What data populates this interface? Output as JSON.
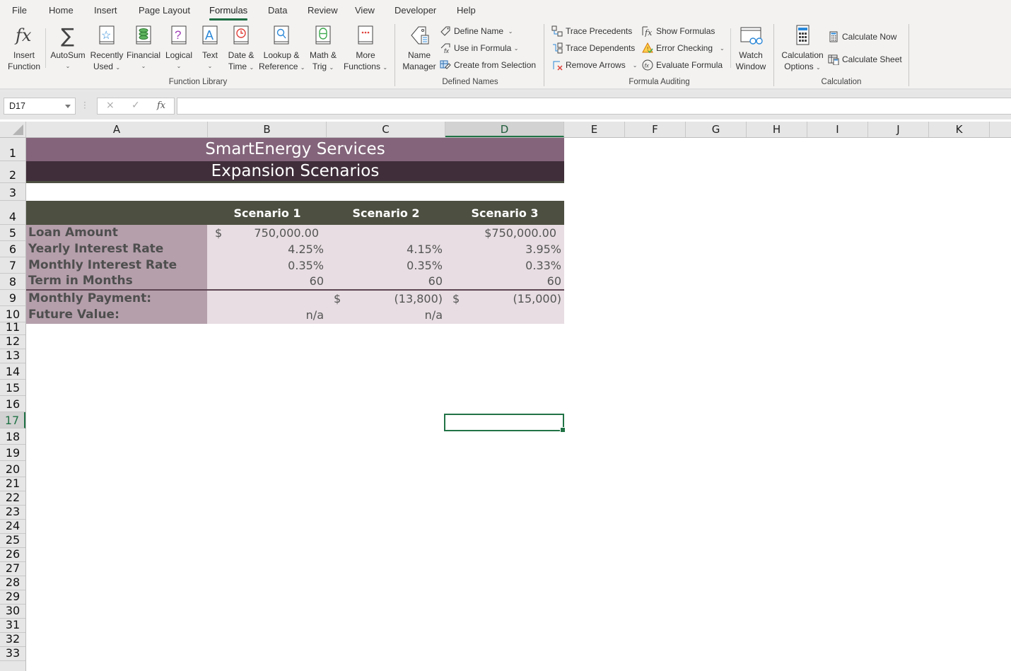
{
  "menu": {
    "tabs": [
      "File",
      "Home",
      "Insert",
      "Page Layout",
      "Formulas",
      "Data",
      "Review",
      "View",
      "Developer",
      "Help"
    ],
    "active_tab": "Formulas"
  },
  "ribbon": {
    "function_library": {
      "label": "Function Library",
      "insert_function": [
        "Insert",
        "Function"
      ],
      "autosum": "AutoSum",
      "recently_used": [
        "Recently",
        "Used"
      ],
      "financial": "Financial",
      "logical": "Logical",
      "text": "Text",
      "date_time": [
        "Date &",
        "Time"
      ],
      "lookup_reference": [
        "Lookup &",
        "Reference"
      ],
      "math_trig": [
        "Math &",
        "Trig"
      ],
      "more_functions": [
        "More",
        "Functions"
      ]
    },
    "defined_names": {
      "label": "Defined Names",
      "name_manager": [
        "Name",
        "Manager"
      ],
      "define_name": "Define Name",
      "use_in_formula": "Use in Formula",
      "create_from_selection": "Create from Selection"
    },
    "formula_auditing": {
      "label": "Formula Auditing",
      "trace_precedents": "Trace Precedents",
      "trace_dependents": "Trace Dependents",
      "remove_arrows": "Remove Arrows",
      "show_formulas": "Show Formulas",
      "error_checking": "Error Checking",
      "evaluate_formula": "Evaluate Formula",
      "watch_window": [
        "Watch",
        "Window"
      ]
    },
    "calculation": {
      "label": "Calculation",
      "calculation_options": [
        "Calculation",
        "Options"
      ],
      "calculate_now": "Calculate Now",
      "calculate_sheet": "Calculate Sheet"
    }
  },
  "formula_bar": {
    "name_box": "D17",
    "formula": "",
    "cancel_icon": "×",
    "enter_icon": "✓",
    "fx_icon": "fx"
  },
  "columns": [
    "A",
    "B",
    "C",
    "D",
    "E",
    "F",
    "G",
    "H",
    "I",
    "J",
    "K"
  ],
  "selected_column": "D",
  "selected_row": "17",
  "rows": [
    "1",
    "2",
    "3",
    "4",
    "5",
    "6",
    "7",
    "8",
    "9",
    "10",
    "11",
    "12",
    "13",
    "14",
    "15",
    "16",
    "17",
    "18",
    "19",
    "20",
    "21",
    "22",
    "23",
    "24",
    "25",
    "26",
    "27",
    "28",
    "29",
    "30",
    "31",
    "32",
    "33"
  ],
  "sheet": {
    "title": "SmartEnergy Services",
    "subtitle": "Expansion Scenarios",
    "headers": [
      "",
      "Scenario 1",
      "Scenario 2",
      "Scenario 3"
    ],
    "labels": [
      "Loan Amount",
      "Yearly Interest Rate",
      "Monthly Interest Rate",
      "Term in Months",
      "Monthly Payment:",
      "Future Value:"
    ],
    "scenario1": {
      "loan_currency": "$",
      "loan_amount": "750,000.00",
      "yearly_rate": "4.25%",
      "monthly_rate": "0.35%",
      "term": "60",
      "monthly_payment_currency": "",
      "monthly_payment": "",
      "future_value": "n/a"
    },
    "scenario2": {
      "loan_amount": "",
      "yearly_rate": "4.15%",
      "monthly_rate": "0.35%",
      "term": "60",
      "monthly_payment_currency": "$",
      "monthly_payment": "(13,800)",
      "future_value": "n/a"
    },
    "scenario3": {
      "loan_amount": "$750,000.00",
      "yearly_rate": "3.95%",
      "monthly_rate": "0.33%",
      "term": "60",
      "monthly_payment_currency": "$",
      "monthly_payment": "(15,000)",
      "future_value": ""
    }
  },
  "colors": {
    "title_band": "#83647a",
    "subtitle_band": "#402f3b",
    "header_band": "#4d5041",
    "label_fill": "#b59fab",
    "value_fill": "#e7dde2",
    "selection": "#217346"
  }
}
